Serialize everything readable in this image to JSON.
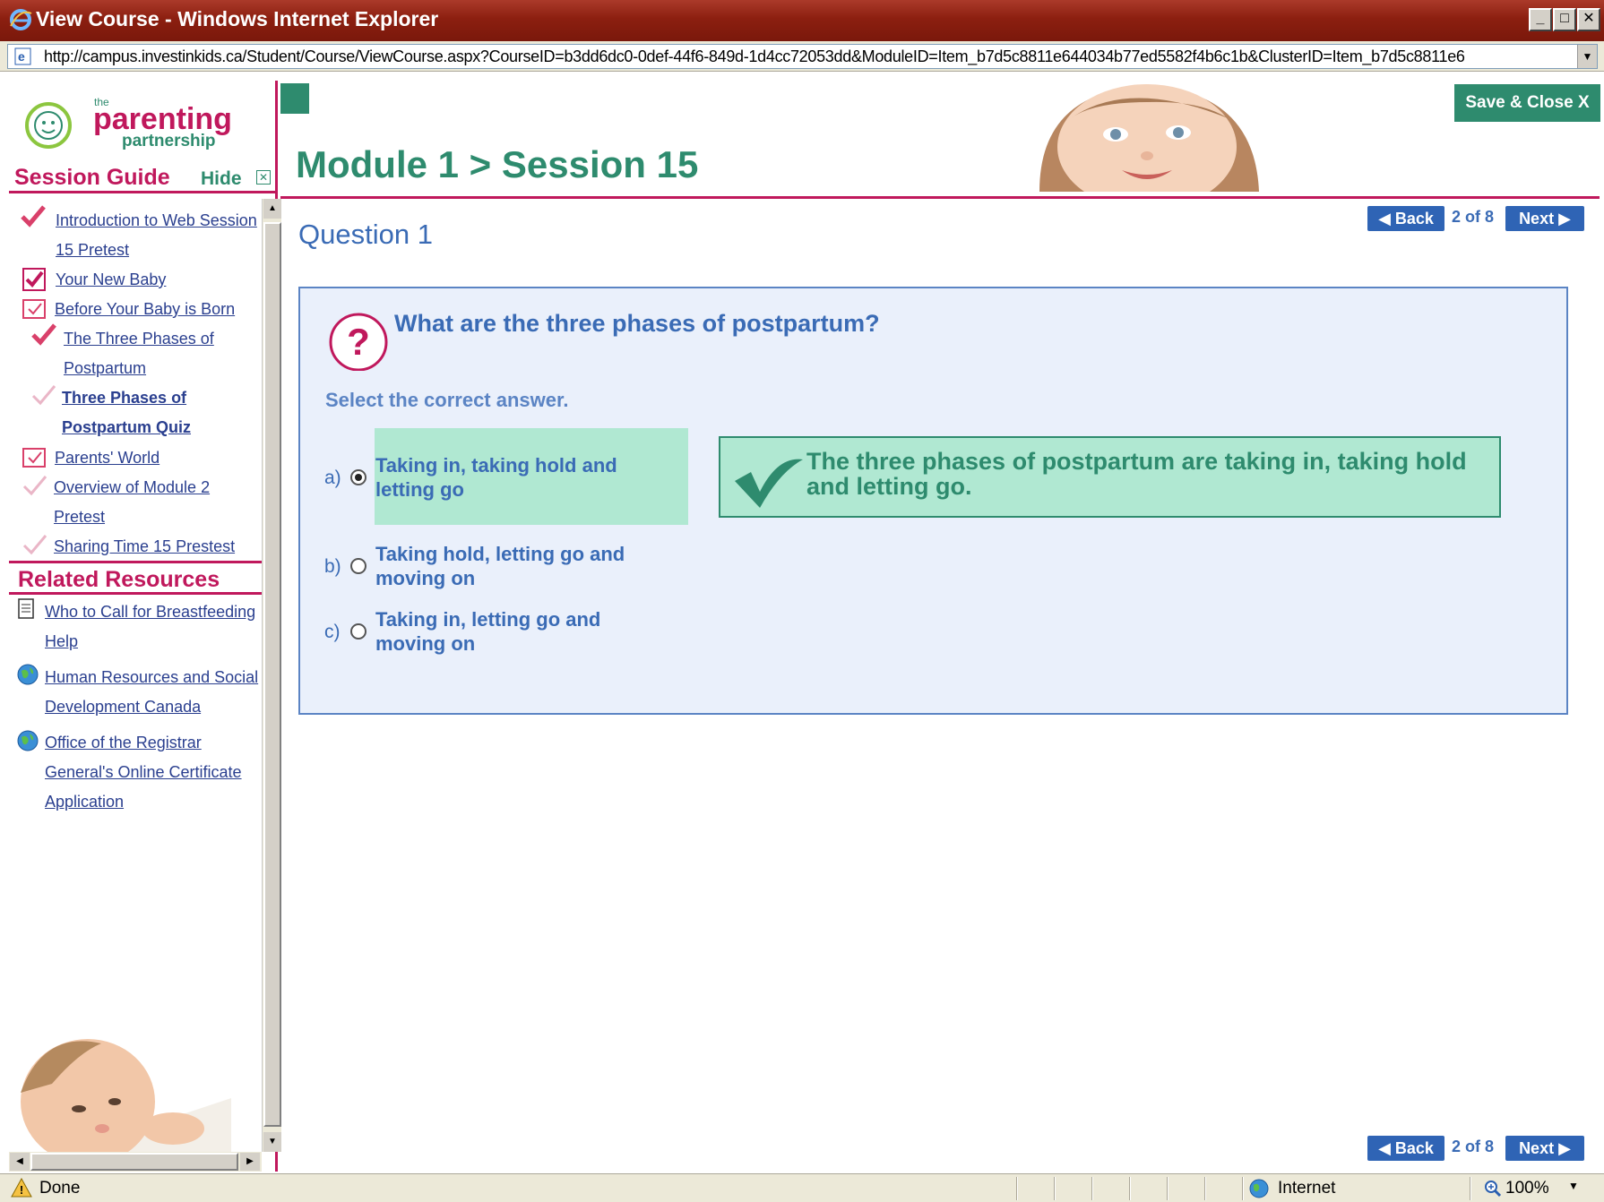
{
  "window": {
    "title": "View Course - Windows Internet Explorer",
    "url": "http://campus.investinkids.ca/Student/Course/ViewCourse.aspx?CourseID=b3dd6dc0-0def-44f6-849d-1d4cc72053dd&ModuleID=Item_b7d5c8811e644034b77ed5582f4b6c1b&ClusterID=Item_b7d5c8811e6",
    "controls": {
      "minimize": "_",
      "maximize": "□",
      "close": "✕"
    }
  },
  "logo": {
    "the": "the",
    "parenting": "parenting",
    "partnership": "partnership"
  },
  "sidebar": {
    "session_guide": "Session Guide",
    "hide": "Hide",
    "items": [
      {
        "label": "Introduction to Web Session",
        "label2": "15 Pretest"
      },
      {
        "label": "Your New Baby"
      },
      {
        "label": "Before Your Baby is Born"
      },
      {
        "label": "The Three Phases of",
        "label2": "Postpartum"
      },
      {
        "label": "Three Phases of",
        "label2": "Postpartum Quiz"
      },
      {
        "label": "Parents' World"
      },
      {
        "label": "Overview of Module 2",
        "label2": "Pretest"
      },
      {
        "label": "Sharing Time 15 Prestest"
      }
    ],
    "related_resources": "Related Resources",
    "resources": [
      {
        "label": "Who to Call for Breastfeeding",
        "label2": "Help",
        "icon": "document-icon"
      },
      {
        "label": "Human Resources and Social",
        "label2": "Development Canada",
        "icon": "globe-icon"
      },
      {
        "label": "Office of the Registrar",
        "label2": "General's Online Certificate",
        "label3": "Application",
        "icon": "globe-icon"
      }
    ]
  },
  "header": {
    "module_title": "Module 1 > Session 15",
    "save_close": "Save & Close  X"
  },
  "nav": {
    "back": "◀ Back",
    "next": "Next ▶",
    "pager": "2 of 8"
  },
  "question": {
    "title": "Question 1",
    "text": "What are the three phases of postpartum?",
    "instruction": "Select the correct answer.",
    "options": [
      {
        "letter": "a)",
        "line1": "Taking in, taking hold and",
        "line2": "letting go",
        "selected": true
      },
      {
        "letter": "b)",
        "line1": "Taking hold, letting go and",
        "line2": "moving on",
        "selected": false
      },
      {
        "letter": "c)",
        "line1": "Taking in, letting go and",
        "line2": "moving on",
        "selected": false
      }
    ],
    "feedback": "The three phases of postpartum are taking in, taking hold and letting go."
  },
  "status": {
    "text": "Done",
    "zone": "Internet",
    "zoom": "100%"
  }
}
